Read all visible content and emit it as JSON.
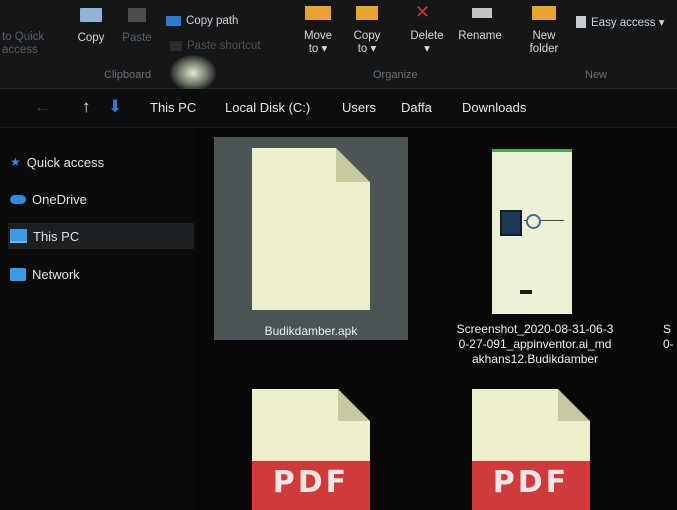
{
  "ribbon": {
    "pin_label_line1": "to Quick",
    "pin_label_line2": "access",
    "copy": "Copy",
    "paste": "Paste",
    "copy_path": "Copy path",
    "paste_shortcut": "Paste shortcut",
    "move_to": "Move",
    "move_to_2": "to ▾",
    "copy_to": "Copy",
    "copy_to_2": "to ▾",
    "delete": "Delete",
    "delete_2": "▾",
    "rename": "Rename",
    "new_folder_1": "New",
    "new_folder_2": "folder",
    "easy_access": "Easy access ▾",
    "groups": {
      "clipboard": "Clipboard",
      "organize": "Organize",
      "new": "New"
    }
  },
  "breadcrumb": [
    "This PC",
    "Local Disk (C:)",
    "Users",
    "Daffa",
    "Downloads"
  ],
  "sidebar": {
    "items": [
      {
        "label": "Quick access",
        "icon": "star-icon"
      },
      {
        "label": "OneDrive",
        "icon": "cloud-icon"
      },
      {
        "label": "This PC",
        "icon": "monitor-icon"
      },
      {
        "label": "Network",
        "icon": "network-icon"
      }
    ]
  },
  "files": [
    {
      "name": "Budikdamber.apk",
      "type": "apk",
      "selected": true
    },
    {
      "name_l1": "Screenshot_2020-08-31-06-3",
      "name_l2": "0-27-091_appinventor.ai_md",
      "name_l3": "akhans12.Budikdamber",
      "type": "image"
    },
    {
      "name_l1": "S",
      "name_l2": "0-",
      "type": "partial"
    }
  ],
  "pdf_files": [
    {
      "badge": "PDF"
    },
    {
      "badge": "PDF"
    }
  ],
  "colors": {
    "accent": "#1a73c7",
    "pdf": "#d03a38",
    "selection": "#4a5356"
  }
}
